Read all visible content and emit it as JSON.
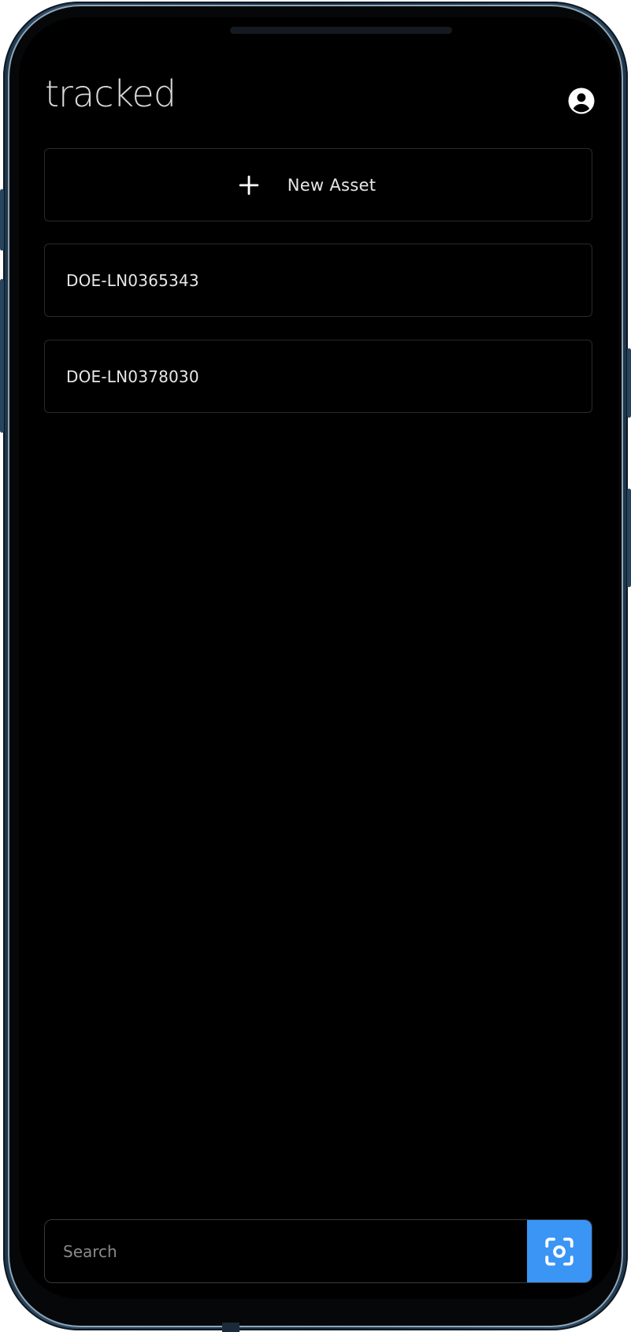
{
  "header": {
    "app_title": "tracked",
    "profile_icon": "account-circle-icon"
  },
  "actions": {
    "new_asset_label": "New Asset",
    "new_asset_icon": "plus-icon"
  },
  "assets": [
    {
      "id": "DOE-LN0365343"
    },
    {
      "id": "DOE-LN0378030"
    }
  ],
  "search": {
    "placeholder": "Search",
    "value": "",
    "scan_icon": "scan-icon"
  },
  "colors": {
    "background": "#000000",
    "accent": "#3a95f5",
    "text": "#e6e6e6",
    "title": "#d8d8d8",
    "card_border": "#2a2a2a"
  }
}
